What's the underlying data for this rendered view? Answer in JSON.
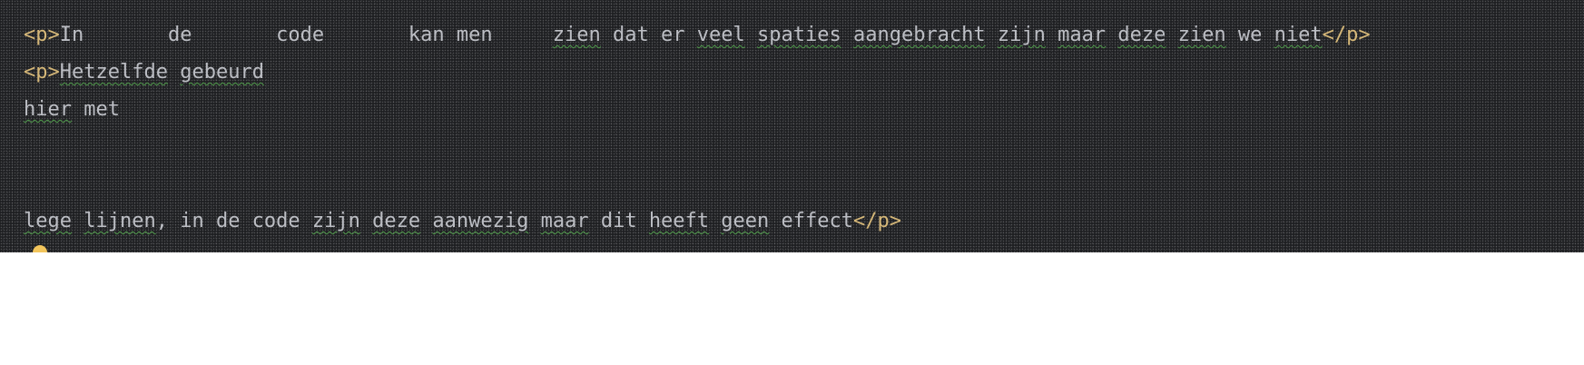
{
  "colors": {
    "editor_bg": "#1e1f22",
    "text": "#bcbec4",
    "tag": "#d5b778",
    "typo_underline": "#4f9a4a",
    "bulb": "#f2c55c"
  },
  "code": {
    "line1": {
      "open_tag": "<p>",
      "seg1": "In       de       code       kan men     ",
      "w_zien": "zien",
      "seg2": " dat er ",
      "w_veel": "veel",
      "seg3": " ",
      "w_spaties": "spaties",
      "seg4": " ",
      "w_aangebracht": "aangebracht",
      "seg5": " ",
      "w_zijn": "zijn",
      "seg6": " ",
      "w_maar": "maar",
      "seg7": " ",
      "w_deze": "deze",
      "seg8": " ",
      "w_zien2": "zien",
      "seg9": " we ",
      "w_niet": "niet",
      "close_tag": "</p>"
    },
    "line2": {
      "open_tag": "<p>",
      "w_hetzelfde": "Hetzelfde",
      "seg1": " ",
      "w_gebeurd": "gebeurd"
    },
    "line3": {
      "w_hier": "hier",
      "seg1": " met"
    },
    "line4": {
      "w_lege": "lege",
      "seg1": " ",
      "w_lijnen": "lijnen",
      "seg2": ", in de code ",
      "w_zijn": "zijn",
      "seg3": " ",
      "w_deze": "deze",
      "seg4": " ",
      "w_aanwezig": "aanwezig",
      "seg5": " ",
      "w_maar": "maar",
      "seg6": " dit ",
      "w_heeft": "heeft",
      "seg7": " ",
      "w_geen": "geen",
      "seg8": " effect",
      "close_tag": "</p>"
    }
  },
  "gutter": {
    "intention_icon": "lightbulb-icon"
  }
}
